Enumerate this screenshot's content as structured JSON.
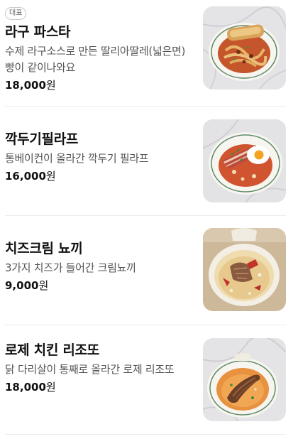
{
  "menu": {
    "items": [
      {
        "badge": "대표",
        "name": "라구 파스타",
        "description": "수제 라구소스로 만든 딸리아딸레(넓은면) 빵이 같이나와요",
        "price": "18,000",
        "currency": "원",
        "image_icon": "ragu-pasta-image"
      },
      {
        "name": "깍두기필라프",
        "description": "통베이컨이 올라간 깍두기 필라프",
        "price": "16,000",
        "currency": "원",
        "image_icon": "kkakdugi-pilaf-image"
      },
      {
        "name": "치즈크림 뇨끼",
        "description": "3가지 치즈가 들어간 크림뇨끼",
        "price": "9,000",
        "currency": "원",
        "image_icon": "cheese-cream-gnocchi-image"
      },
      {
        "name": "로제 치킨 리조또",
        "description": "닭 다리살이 통째로 올라간 로제 리조또",
        "price": "18,000",
        "currency": "원",
        "image_icon": "rose-chicken-risotto-image"
      }
    ]
  },
  "colors": {
    "text_primary": "#111111",
    "text_secondary": "#555555",
    "divider": "#ececec",
    "badge_border": "#c9c9c9"
  }
}
